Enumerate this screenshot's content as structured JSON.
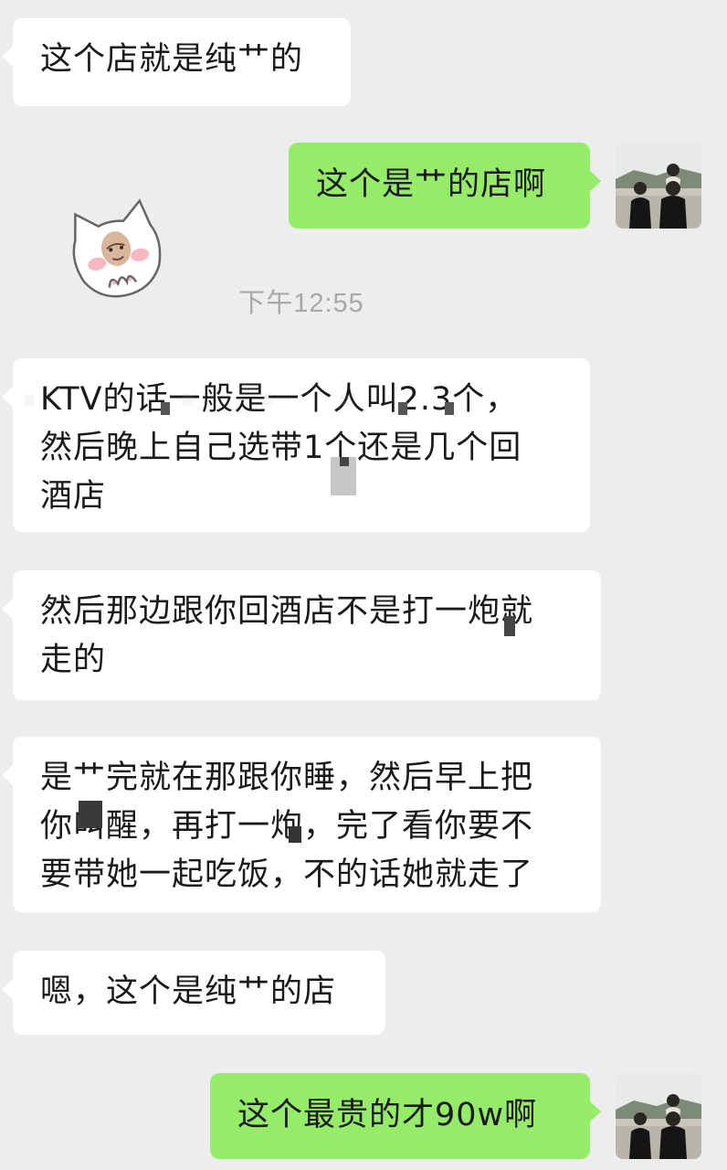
{
  "conversation": {
    "timestamp": "下午12:55",
    "messages": [
      {
        "id": "m1",
        "lines": [
          "这个店就是纯艹的"
        ]
      },
      {
        "id": "m2",
        "lines": [
          "这个是艹的店啊"
        ]
      },
      {
        "id": "m3",
        "lines": [
          "KTV的话一般是一个人叫2.3个，",
          "然后晚上自己选带1个还是几个回",
          "酒店"
        ]
      },
      {
        "id": "m4",
        "lines": [
          "然后那边跟你回酒店不是打一炮就",
          "走的"
        ]
      },
      {
        "id": "m5",
        "lines": [
          "是艹完就在那跟你睡，然后早上把",
          "你叫醒，再打一炮，完了看你要不",
          "要带她一起吃饭，不的话她就走了"
        ]
      },
      {
        "id": "m6",
        "lines": [
          "嗯，这个是纯艹的店"
        ]
      },
      {
        "id": "m7",
        "lines": [
          "这个最贵的才90w啊"
        ]
      }
    ]
  },
  "icons": {
    "sticker": "cartoon-cat-face-sticker-icon",
    "self_avatar": "couple-at-beach-avatar-icon",
    "mosaic": "pixelated-censor-block"
  },
  "colors": {
    "background": "#ededed",
    "incoming_bubble": "#ffffff",
    "outgoing_bubble": "#95ec69",
    "timestamp_text": "#a8a8a8"
  }
}
